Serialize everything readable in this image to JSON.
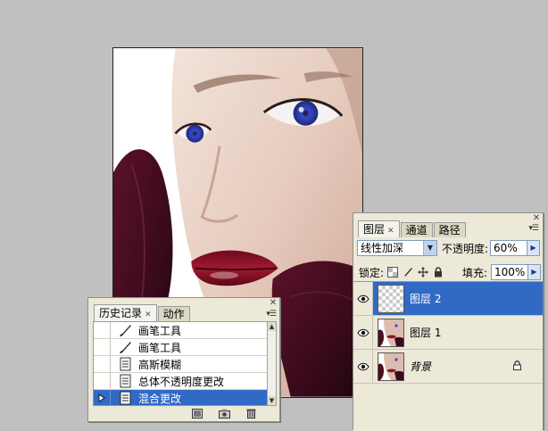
{
  "history_panel": {
    "tabs": [
      {
        "label": "历史记录",
        "active": true
      },
      {
        "label": "动作",
        "active": false
      }
    ],
    "items": [
      {
        "label": "画笔工具",
        "icon": "brush-icon",
        "selected": false
      },
      {
        "label": "画笔工具",
        "icon": "brush-icon",
        "selected": false
      },
      {
        "label": "高斯模糊",
        "icon": "document-icon",
        "selected": false
      },
      {
        "label": "总体不透明度更改",
        "icon": "document-icon",
        "selected": false
      },
      {
        "label": "混合更改",
        "icon": "document-icon",
        "selected": true
      }
    ],
    "footer_icons": [
      "new-document-from-state-icon",
      "camera-snapshot-icon",
      "trash-icon"
    ]
  },
  "layers_panel": {
    "tabs": [
      {
        "label": "图层",
        "active": true
      },
      {
        "label": "通道",
        "active": false
      },
      {
        "label": "路径",
        "active": false
      }
    ],
    "blend_mode": "线性加深",
    "opacity_label": "不透明度:",
    "opacity_value": "60%",
    "lock_label": "锁定:",
    "fill_label": "填充:",
    "fill_value": "100%",
    "layers": [
      {
        "name": "图层 2",
        "thumb": "transparent",
        "selected": true,
        "locked": false
      },
      {
        "name": "图层 1",
        "thumb": "photo",
        "selected": false,
        "locked": false
      },
      {
        "name": "背景",
        "thumb": "photo",
        "selected": false,
        "locked": true
      }
    ]
  },
  "colors": {
    "workspace": "#c0c0c0",
    "panel": "#ece9d8",
    "selection": "#316ac5",
    "lip_red": "#7a0d22",
    "eye_blue": "#3a48c8"
  }
}
